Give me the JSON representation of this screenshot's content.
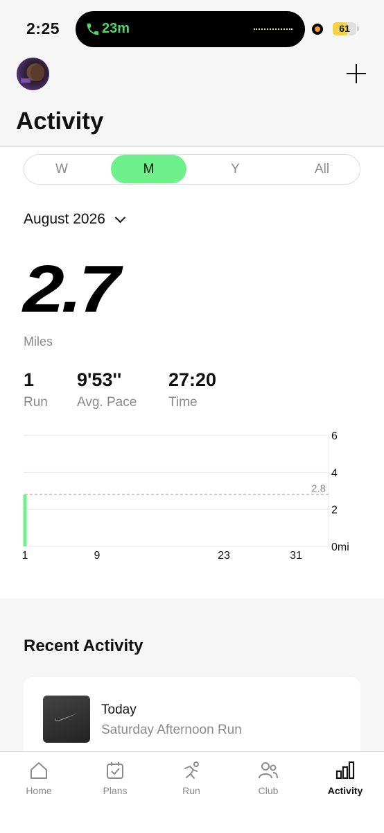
{
  "status_bar": {
    "time": "2:25",
    "call_duration": "23m",
    "battery": "61",
    "battery_level": 0.61
  },
  "header": {
    "title": "Activity",
    "add_icon": "plus-icon",
    "avatar": "user-avatar"
  },
  "period_tabs": [
    {
      "label": "W",
      "active": false
    },
    {
      "label": "M",
      "active": true
    },
    {
      "label": "Y",
      "active": false
    },
    {
      "label": "All",
      "active": false
    }
  ],
  "month": "August 2026",
  "summary": {
    "distance": "2.7",
    "unit": "Miles"
  },
  "stats": [
    {
      "value": "1",
      "label": "Run"
    },
    {
      "value": "9'53''",
      "label": "Avg. Pace"
    },
    {
      "value": "27:20",
      "label": "Time"
    }
  ],
  "chart_data": {
    "type": "bar",
    "x": [
      1
    ],
    "values": [
      2.8
    ],
    "x_ticks": [
      "1",
      "9",
      "23",
      "31"
    ],
    "y_ticks": [
      "0mi",
      "2",
      "4",
      "6"
    ],
    "ylim": [
      0,
      6
    ],
    "xlim": [
      1,
      31
    ],
    "reference_line": {
      "value": 2.8,
      "label": "2.8"
    },
    "bar_color": "#6ef08a",
    "grid": true
  },
  "recent": {
    "title": "Recent Activity",
    "items": [
      {
        "date": "Today",
        "name": "Saturday Afternoon Run",
        "icon": "swoosh-icon"
      }
    ]
  },
  "tab_bar": [
    {
      "label": "Home",
      "icon": "home-icon",
      "active": false
    },
    {
      "label": "Plans",
      "icon": "calendar-check-icon",
      "active": false
    },
    {
      "label": "Run",
      "icon": "runner-icon",
      "active": false
    },
    {
      "label": "Club",
      "icon": "people-icon",
      "active": false
    },
    {
      "label": "Activity",
      "icon": "bar-chart-icon",
      "active": true
    }
  ],
  "colors": {
    "accent": "#6ef08a",
    "call_green": "#4cd964",
    "battery_yellow": "#f5d442"
  }
}
